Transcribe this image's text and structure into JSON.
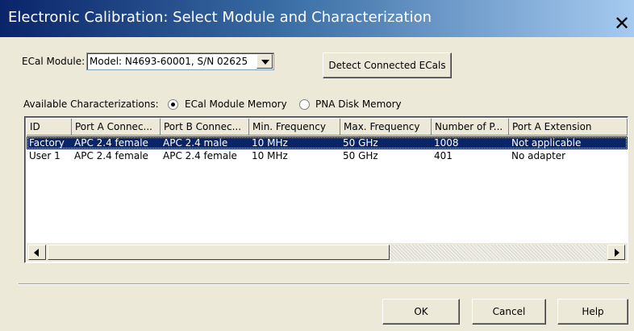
{
  "window": {
    "title": "Electronic Calibration: Select Module and Characterization",
    "close_glyph": "✕"
  },
  "module": {
    "label": "ECal Module:",
    "selected": "Model: N4693-60001, S/N 02625"
  },
  "detect_button": "Detect Connected ECals",
  "characterizations": {
    "label": "Available Characterizations:",
    "options": [
      {
        "label": "ECal Module Memory",
        "checked": true
      },
      {
        "label": "PNA Disk Memory",
        "checked": false
      }
    ]
  },
  "table": {
    "columns": [
      "ID",
      "Port A Connec...",
      "Port B Connec...",
      "Min. Frequency",
      "Max. Frequency",
      "Number of P...",
      "Port A Extension"
    ],
    "rows": [
      [
        "Factory",
        "APC 2.4 female",
        "APC 2.4 male",
        "10 MHz",
        "50 GHz",
        "1008",
        "Not applicable"
      ],
      [
        "User 1",
        "APC 2.4 female",
        "APC 2.4 female",
        "10 MHz",
        "50 GHz",
        "401",
        "No adapter"
      ]
    ],
    "selected_row": 0
  },
  "buttons": {
    "ok": "OK",
    "cancel": "Cancel",
    "help": "Help"
  },
  "colors": {
    "title_gradient_start": "#0a246a",
    "title_gradient_end": "#a6caf0",
    "selection": "#0a246a",
    "face": "#ece9d8"
  }
}
